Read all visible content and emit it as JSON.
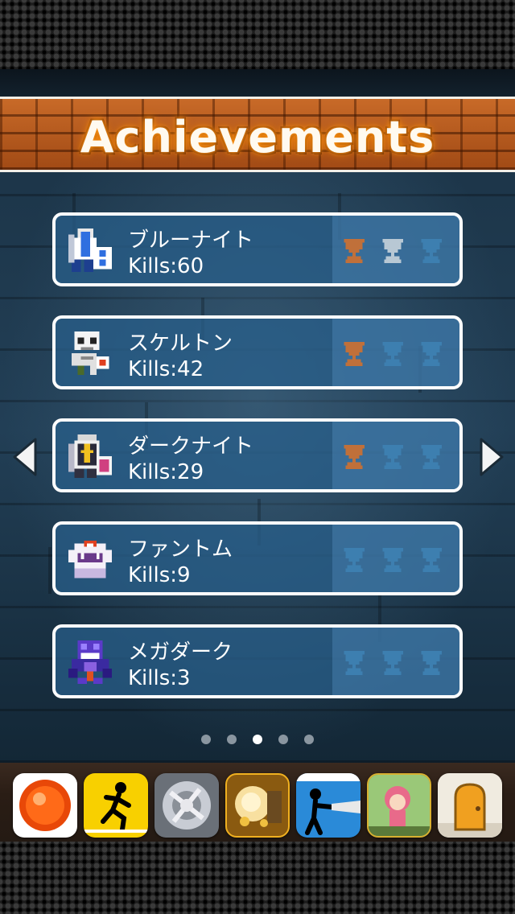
{
  "header": {
    "title": "Achievements"
  },
  "colors": {
    "bronze": "#c0703a",
    "silver": "#b8c8d4",
    "empty_trophy": "#3d7fb0",
    "row_bg": "#2b6a99",
    "banner": "#b4581d"
  },
  "achievements": [
    {
      "name": "ブルーナイト",
      "kills": "Kills:60",
      "avatar": "blue-knight-icon",
      "trophies": [
        "bronze",
        "silver",
        "empty"
      ]
    },
    {
      "name": "スケルトン",
      "kills": "Kills:42",
      "avatar": "skeleton-icon",
      "trophies": [
        "bronze",
        "empty",
        "empty"
      ]
    },
    {
      "name": "ダークナイト",
      "kills": "Kills:29",
      "avatar": "dark-knight-icon",
      "trophies": [
        "bronze",
        "empty",
        "empty"
      ]
    },
    {
      "name": "ファントム",
      "kills": "Kills:9",
      "avatar": "phantom-icon",
      "trophies": [
        "empty",
        "empty",
        "empty"
      ]
    },
    {
      "name": "メガダーク",
      "kills": "Kills:3",
      "avatar": "mega-dark-icon",
      "trophies": [
        "empty",
        "empty",
        "empty"
      ]
    }
  ],
  "navigation": {
    "prev": "left-arrow-icon",
    "next": "right-arrow-icon"
  },
  "pagination": {
    "total": 5,
    "current": 3
  },
  "app_bar": {
    "apps": [
      "orange-ball-icon",
      "stickman-running-icon",
      "silver-gear-icon",
      "golden-explosion-icon",
      "stickman-saw-icon",
      "pink-hair-girl-icon",
      "door-icon"
    ]
  }
}
